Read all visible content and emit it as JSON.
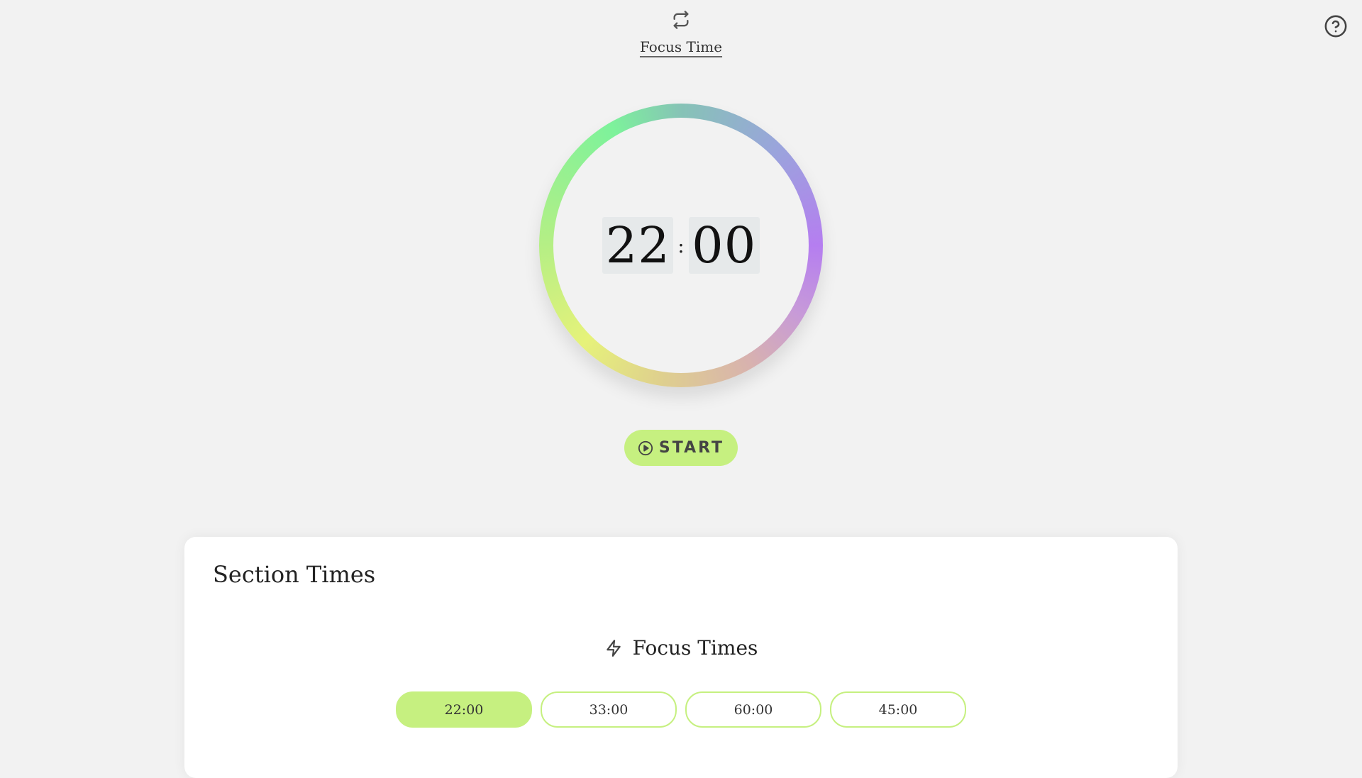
{
  "header": {
    "mode_label": "Focus Time",
    "swap_icon": "swap-arrows-icon",
    "help_icon": "help-circle-icon"
  },
  "timer": {
    "minutes": "22",
    "seconds": "00",
    "separator": ":"
  },
  "controls": {
    "start_label": "START",
    "start_icon": "play-circle-icon"
  },
  "section_times": {
    "title": "Section Times",
    "focus": {
      "heading": "Focus Times",
      "icon": "lightning-icon",
      "options": [
        "22:00",
        "33:00",
        "60:00",
        "45:00"
      ],
      "selected_index": 0
    }
  },
  "colors": {
    "background": "#f2f2f2",
    "accent": "#c6f080",
    "card": "#ffffff"
  }
}
